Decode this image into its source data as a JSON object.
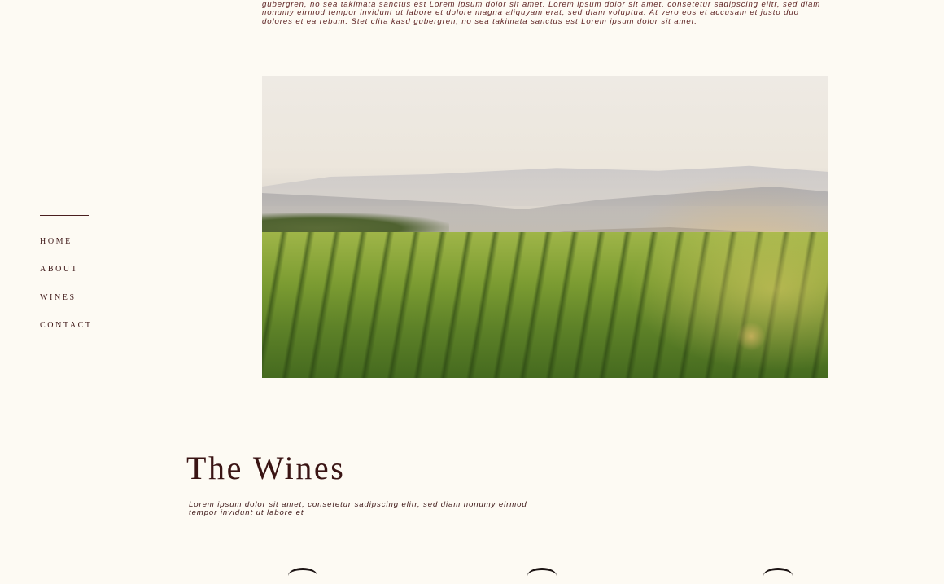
{
  "intro": {
    "text": "labore et dolore magna aliquyam erat, sed diam voluptua. At vero eos et accusam et justo duo dolores et ea rebum. Stet clita kasd gubergren, no sea takimata sanctus est Lorem ipsum dolor sit amet. Lorem ipsum dolor sit amet, consetetur sadipscing elitr, sed diam nonumy eirmod tempor invidunt ut labore et dolore magna aliquyam erat, sed diam voluptua. At vero eos et accusam et justo duo dolores et ea rebum. Stet clita kasd gubergren, no sea takimata sanctus est Lorem ipsum dolor sit amet."
  },
  "nav": {
    "items": [
      {
        "label": "HOME"
      },
      {
        "label": "ABOUT"
      },
      {
        "label": "WINES"
      },
      {
        "label": "CONTACT"
      }
    ]
  },
  "hero": {
    "image_subject": "vineyard-landscape"
  },
  "wines": {
    "title": "The Wines",
    "text": "Lorem ipsum dolor sit amet, consetetur sadipscing elitr, sed diam nonumy eirmod tempor invidunt ut labore et"
  },
  "colors": {
    "background": "#fdfaf3",
    "text": "#3d1616",
    "accent": "#5a1e1e"
  }
}
